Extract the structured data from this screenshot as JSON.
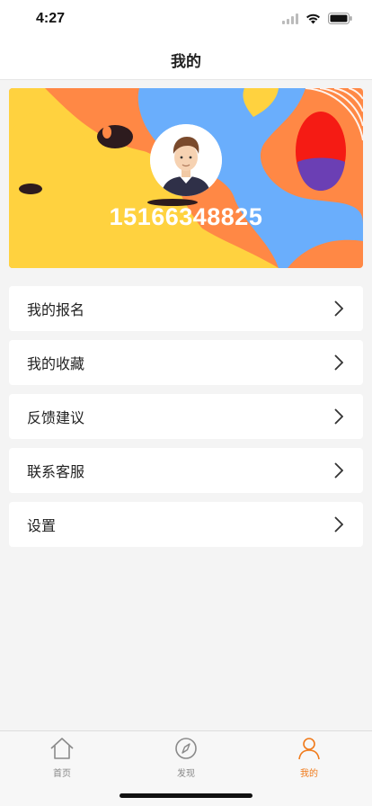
{
  "status_bar": {
    "time": "4:27"
  },
  "nav": {
    "title": "我的"
  },
  "profile": {
    "phone": "15166348825"
  },
  "menu": {
    "items": [
      {
        "label": "我的报名"
      },
      {
        "label": "我的收藏"
      },
      {
        "label": "反馈建议"
      },
      {
        "label": "联系客服"
      },
      {
        "label": "设置"
      }
    ]
  },
  "tabs": [
    {
      "label": "首页",
      "icon": "home-icon",
      "active": false
    },
    {
      "label": "发现",
      "icon": "compass-icon",
      "active": false
    },
    {
      "label": "我的",
      "icon": "user-icon",
      "active": true
    }
  ],
  "colors": {
    "accent": "#f07a1a",
    "banner_orange": "#ff8845",
    "banner_yellow": "#ffd23f",
    "banner_blue": "#6aaefc",
    "banner_red": "#f51b14"
  }
}
